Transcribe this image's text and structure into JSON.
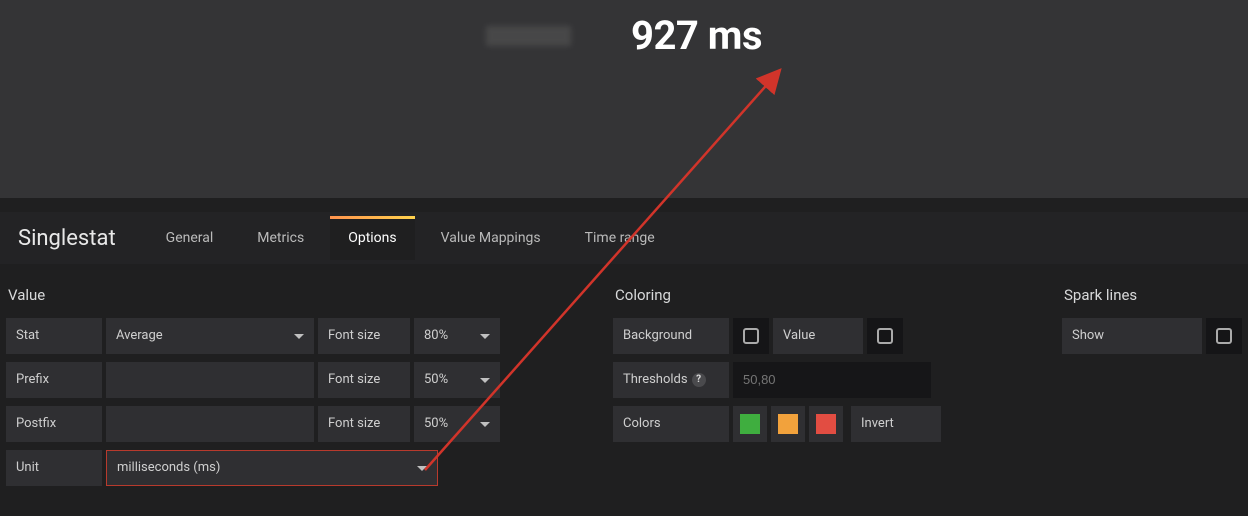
{
  "preview": {
    "stat_display": "927 ms"
  },
  "editor": {
    "panel_title": "Singlestat",
    "tabs": [
      "General",
      "Metrics",
      "Options",
      "Value Mappings",
      "Time range"
    ],
    "active_tab_index": 2
  },
  "sections": {
    "value": {
      "title": "Value",
      "labels": {
        "stat": "Stat",
        "prefix": "Prefix",
        "postfix": "Postfix",
        "unit": "Unit",
        "font_size": "Font size"
      },
      "stat_value": "Average",
      "prefix_value": "",
      "postfix_value": "",
      "unit_value": "milliseconds (ms)",
      "font_stat": "80%",
      "font_prefix": "50%",
      "font_postfix": "50%"
    },
    "coloring": {
      "title": "Coloring",
      "labels": {
        "background": "Background",
        "value": "Value",
        "thresholds": "Thresholds",
        "colors": "Colors",
        "invert": "Invert"
      },
      "thresholds_placeholder": "50,80",
      "colors": [
        "#3fae3f",
        "#f2a23c",
        "#e24d42"
      ]
    },
    "sparklines": {
      "title": "Spark lines",
      "labels": {
        "show": "Show"
      }
    }
  }
}
